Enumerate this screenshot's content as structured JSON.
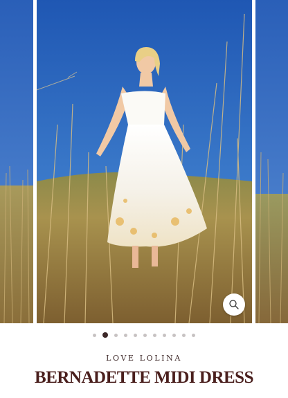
{
  "gallery": {
    "total_images": 11,
    "active_index": 1,
    "zoom_icon": "search-icon",
    "colors": {
      "sky": "#2f6bc4",
      "grass": "#b89a5a",
      "dot_active": "#3d2828",
      "dot_inactive": "#c7c2c2"
    }
  },
  "product": {
    "brand": "LOVE LOLINA",
    "title": "BERNADETTE MIDI DRESS",
    "title_color": "#4a1f1d"
  }
}
